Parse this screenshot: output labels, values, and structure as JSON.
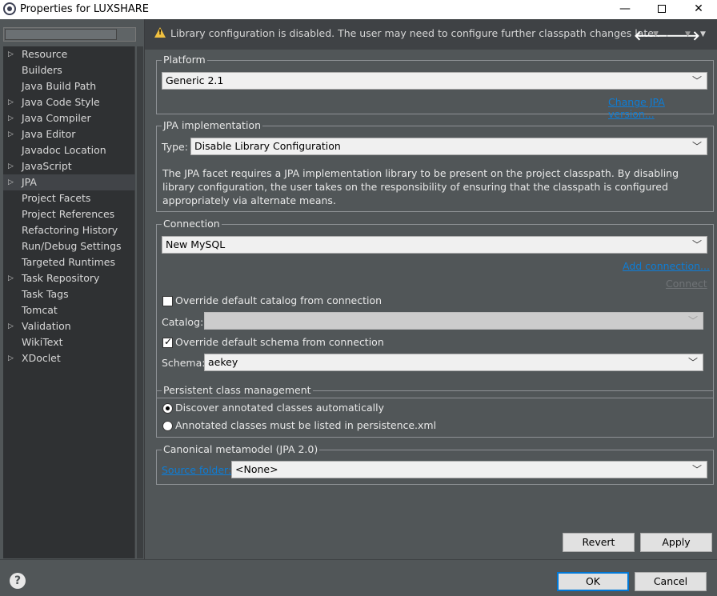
{
  "window": {
    "title": "Properties for LUXSHARE"
  },
  "sidebar": {
    "filter_placeholder": "",
    "items": [
      {
        "label": "Resource",
        "expandable": true
      },
      {
        "label": "Builders",
        "expandable": false
      },
      {
        "label": "Java Build Path",
        "expandable": false
      },
      {
        "label": "Java Code Style",
        "expandable": true
      },
      {
        "label": "Java Compiler",
        "expandable": true
      },
      {
        "label": "Java Editor",
        "expandable": true
      },
      {
        "label": "Javadoc Location",
        "expandable": false
      },
      {
        "label": "JavaScript",
        "expandable": true
      },
      {
        "label": "JPA",
        "expandable": true,
        "selected": true
      },
      {
        "label": "Project Facets",
        "expandable": false
      },
      {
        "label": "Project References",
        "expandable": false
      },
      {
        "label": "Refactoring History",
        "expandable": false
      },
      {
        "label": "Run/Debug Settings",
        "expandable": false
      },
      {
        "label": "Targeted Runtimes",
        "expandable": false
      },
      {
        "label": "Task Repository",
        "expandable": true
      },
      {
        "label": "Task Tags",
        "expandable": false
      },
      {
        "label": "Tomcat",
        "expandable": false
      },
      {
        "label": "Validation",
        "expandable": true
      },
      {
        "label": "WikiText",
        "expandable": false
      },
      {
        "label": "XDoclet",
        "expandable": true
      }
    ]
  },
  "message": {
    "text": "Library configuration is disabled. The user may need to configure further classpath changes later.",
    "icon": "warning-icon"
  },
  "platform": {
    "legend": "Platform",
    "value": "Generic 2.1",
    "link": "Change JPA version..."
  },
  "jpa_impl": {
    "legend": "JPA implementation",
    "type_label": "Type:",
    "type_value": "Disable Library Configuration",
    "description": "The JPA facet requires a JPA implementation library to be present on the project classpath. By disabling library configuration, the user takes on the responsibility of ensuring that the classpath is configured appropriately via alternate means."
  },
  "connection": {
    "legend": "Connection",
    "value": "New MySQL",
    "add_link": "Add connection...",
    "connect_link": "Connect",
    "override_catalog": "Override default catalog from connection",
    "override_catalog_checked": false,
    "catalog_label": "Catalog:",
    "catalog_value": "",
    "override_schema": "Override default schema from connection",
    "override_schema_checked": true,
    "schema_label": "Schema:",
    "schema_value": "aekey"
  },
  "persistent": {
    "legend": "Persistent class management",
    "option1": "Discover annotated classes automatically",
    "option2": "Annotated classes must be listed in persistence.xml",
    "selected": 1
  },
  "canonical": {
    "legend": "Canonical metamodel (JPA 2.0)",
    "source_link": "Source folder:",
    "source_value": "<None>"
  },
  "buttons": {
    "revert": "Revert",
    "apply": "Apply",
    "ok": "OK",
    "cancel": "Cancel"
  }
}
